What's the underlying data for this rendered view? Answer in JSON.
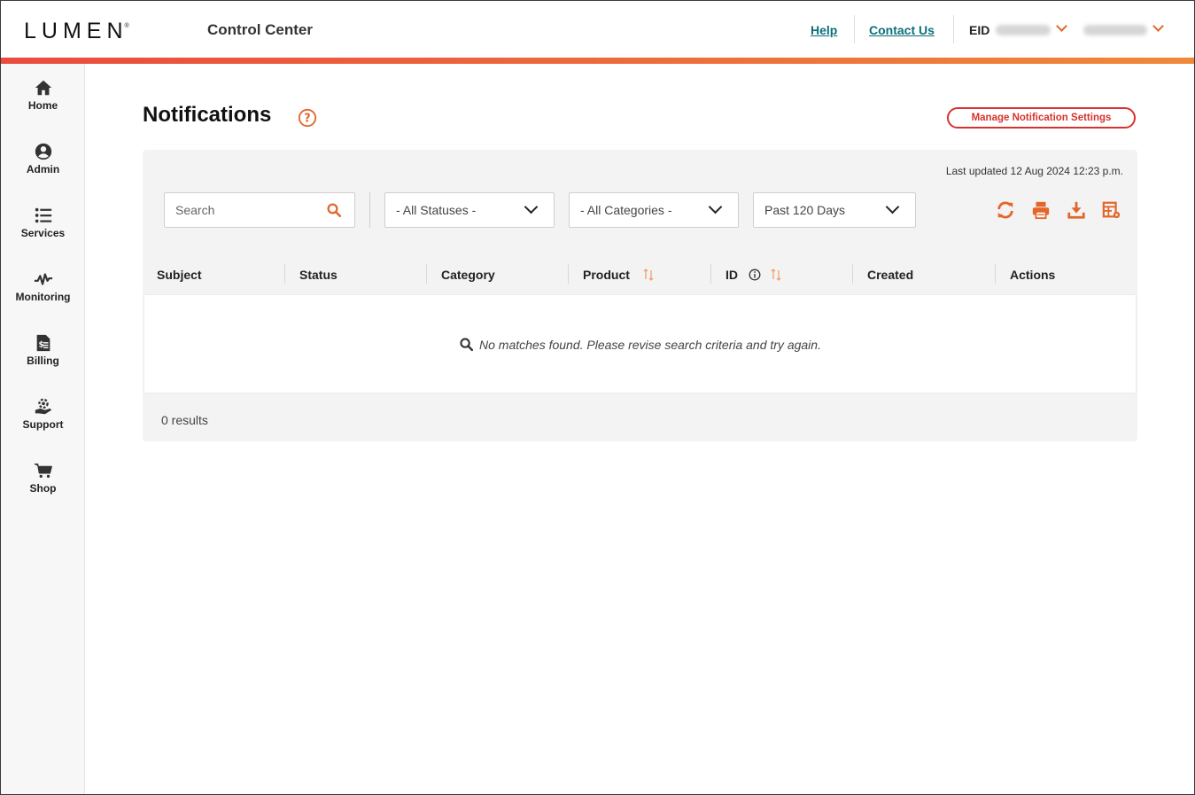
{
  "header": {
    "logo_text": "LUMEN",
    "logo_reg": "®",
    "app_title": "Control Center",
    "help_link": "Help",
    "contact_link": "Contact Us",
    "eid_label": "EID"
  },
  "sidebar": {
    "items": [
      {
        "label": "Home",
        "icon": "home-icon"
      },
      {
        "label": "Admin",
        "icon": "user-circle-icon"
      },
      {
        "label": "Services",
        "icon": "list-icon"
      },
      {
        "label": "Monitoring",
        "icon": "pulse-icon"
      },
      {
        "label": "Billing",
        "icon": "invoice-icon"
      },
      {
        "label": "Support",
        "icon": "support-icon"
      },
      {
        "label": "Shop",
        "icon": "cart-icon"
      }
    ]
  },
  "main": {
    "title": "Notifications",
    "manage_button": "Manage Notification Settings",
    "last_updated": "Last updated 12 Aug 2024 12:23 p.m.",
    "search_placeholder": "Search",
    "filters": {
      "status": "- All Statuses -",
      "category": "- All Categories -",
      "period": "Past 120 Days"
    },
    "table": {
      "columns": [
        "Subject",
        "Status",
        "Category",
        "Product",
        "ID",
        "Created",
        "Actions"
      ],
      "empty_message": "No matches found. Please revise search criteria and try again."
    },
    "results_count": "0 results"
  },
  "colors": {
    "accent_orange": "#e2662a",
    "brand_red": "#d7332c",
    "link_teal": "#0b6f7a",
    "gradient_start": "#ea4b3d",
    "gradient_end": "#f0883a"
  }
}
